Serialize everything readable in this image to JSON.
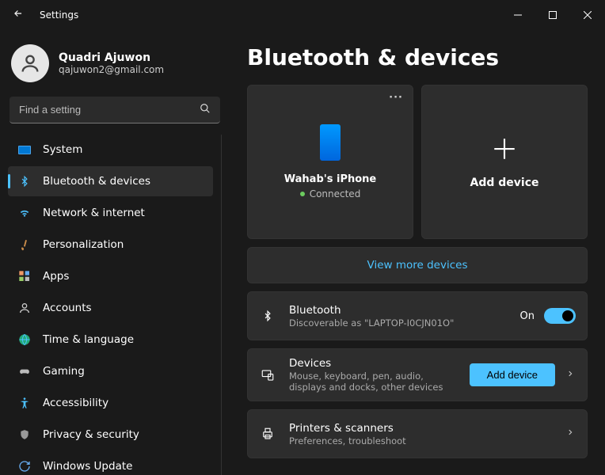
{
  "window": {
    "title": "Settings"
  },
  "user": {
    "name": "Quadri Ajuwon",
    "email": "qajuwon2@gmail.com"
  },
  "search": {
    "placeholder": "Find a setting"
  },
  "nav": {
    "items": [
      {
        "label": "System"
      },
      {
        "label": "Bluetooth & devices",
        "active": true
      },
      {
        "label": "Network & internet"
      },
      {
        "label": "Personalization"
      },
      {
        "label": "Apps"
      },
      {
        "label": "Accounts"
      },
      {
        "label": "Time & language"
      },
      {
        "label": "Gaming"
      },
      {
        "label": "Accessibility"
      },
      {
        "label": "Privacy & security"
      },
      {
        "label": "Windows Update"
      }
    ]
  },
  "page": {
    "title": "Bluetooth & devices",
    "device_card": {
      "name": "Wahab's iPhone",
      "status": "Connected"
    },
    "add_card": {
      "label": "Add device"
    },
    "view_more": "View more devices",
    "bluetooth_row": {
      "title": "Bluetooth",
      "sub": "Discoverable as \"LAPTOP-I0CJN01O\"",
      "state": "On"
    },
    "devices_row": {
      "title": "Devices",
      "sub": "Mouse, keyboard, pen, audio, displays and docks, other devices",
      "button": "Add device"
    },
    "printers_row": {
      "title": "Printers & scanners",
      "sub": "Preferences, troubleshoot"
    }
  }
}
